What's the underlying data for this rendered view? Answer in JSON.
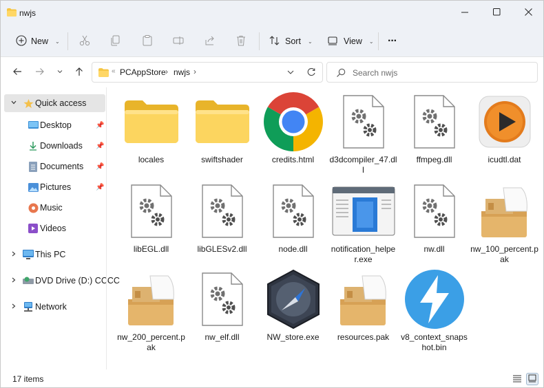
{
  "window": {
    "title": "nwjs"
  },
  "toolbar": {
    "new_label": "New",
    "sort_label": "Sort",
    "view_label": "View",
    "more_label": "···"
  },
  "address": {
    "breadcrumb": [
      "PCAppStore",
      "nwjs"
    ],
    "separator": "›",
    "overflow": "«"
  },
  "search": {
    "placeholder": "Search nwjs"
  },
  "sidebar": {
    "quick_access": "Quick access",
    "items": [
      {
        "label": "Desktop",
        "icon": "desktop-icon",
        "pinned": true
      },
      {
        "label": "Downloads",
        "icon": "download-icon",
        "pinned": true
      },
      {
        "label": "Documents",
        "icon": "documents-icon",
        "pinned": true
      },
      {
        "label": "Pictures",
        "icon": "pictures-icon",
        "pinned": true
      },
      {
        "label": "Music",
        "icon": "music-icon",
        "pinned": false
      },
      {
        "label": "Videos",
        "icon": "videos-icon",
        "pinned": false
      }
    ],
    "this_pc": "This PC",
    "dvd": "DVD Drive (D:) CCCC",
    "network": "Network"
  },
  "files": [
    {
      "name": "locales",
      "type": "folder"
    },
    {
      "name": "swiftshader",
      "type": "folder"
    },
    {
      "name": "credits.html",
      "type": "chrome"
    },
    {
      "name": "d3dcompiler_47.dll",
      "type": "dll"
    },
    {
      "name": "ffmpeg.dll",
      "type": "dll"
    },
    {
      "name": "icudtl.dat",
      "type": "media"
    },
    {
      "name": "libEGL.dll",
      "type": "dll"
    },
    {
      "name": "libGLESv2.dll",
      "type": "dll"
    },
    {
      "name": "node.dll",
      "type": "dll"
    },
    {
      "name": "notification_helper.exe",
      "type": "exe-window"
    },
    {
      "name": "nw.dll",
      "type": "dll"
    },
    {
      "name": "nw_100_percent.pak",
      "type": "package"
    },
    {
      "name": "nw_200_percent.pak",
      "type": "package"
    },
    {
      "name": "nw_elf.dll",
      "type": "dll"
    },
    {
      "name": "NW_store.exe",
      "type": "compass"
    },
    {
      "name": "resources.pak",
      "type": "package"
    },
    {
      "name": "v8_context_snapshot.bin",
      "type": "bolt"
    }
  ],
  "status": {
    "item_count": "17 items"
  },
  "colors": {
    "chrome_bg": "#eef1f6",
    "selection": "#e5e5e5",
    "folder": "#f7c948",
    "accent": "#0067c0"
  }
}
